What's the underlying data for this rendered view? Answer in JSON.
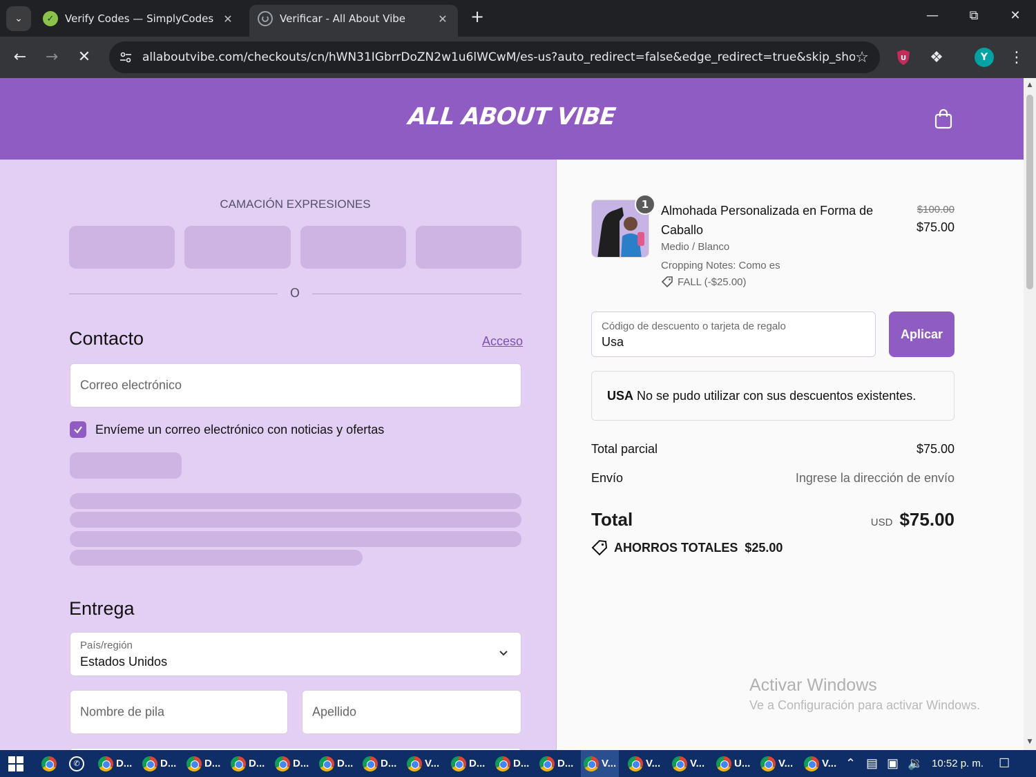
{
  "browser": {
    "tabs": [
      {
        "title": "Verify Codes — SimplyCodes",
        "active": false
      },
      {
        "title": "Verificar - All About Vibe",
        "active": true
      }
    ],
    "url": "allaboutvibe.com/checkouts/cn/hWN31IGbrrDoZN2w1u6lWCwM/es-us?auto_redirect=false&edge_redirect=true&skip_shop...",
    "profile_initial": "Y"
  },
  "store": {
    "logo_text": "ALL ABOUT VIBE",
    "brand_color": "#8e5cc3"
  },
  "express": {
    "title": "CAMACIÓN EXPRESIONES",
    "divider": "O"
  },
  "contact": {
    "heading": "Contacto",
    "login_link": "Acceso",
    "email_placeholder": "Correo electrónico",
    "newsletter_label": "Envíeme un correo electrónico con noticias y ofertas",
    "newsletter_checked": true
  },
  "delivery": {
    "heading": "Entrega",
    "country_label": "País/región",
    "country_value": "Estados Unidos",
    "first_name_placeholder": "Nombre de pila",
    "last_name_placeholder": "Apellido"
  },
  "order": {
    "item": {
      "name": "Almohada Personalizada en Forma de Caballo",
      "quantity": "1",
      "variant": "Medio / Blanco",
      "note": "Cropping Notes: Como es",
      "discount": "FALL (-$25.00)",
      "original_price": "$100.00",
      "price": "$75.00"
    },
    "discount_field": {
      "label": "Código de descuento o tarjeta de regalo",
      "value": "Usa",
      "apply_label": "Aplicar"
    },
    "error": {
      "code": "USA",
      "message": " No se pudo utilizar con sus descuentos existentes."
    },
    "subtotal_label": "Total parcial",
    "subtotal_value": "$75.00",
    "shipping_label": "Envío",
    "shipping_value": "Ingrese la dirección de envío",
    "total_label": "Total",
    "total_currency": "USD",
    "total_value": "$75.00",
    "savings_label": "AHORROS TOTALES",
    "savings_value": "$25.00"
  },
  "watermark": {
    "line1": "Activar Windows",
    "line2": "Ve a Configuración para activar Windows."
  },
  "taskbar": {
    "items": [
      "D...",
      "D...",
      "D...",
      "D...",
      "D...",
      "D...",
      "D...",
      "V...",
      "D...",
      "D...",
      "D...",
      "V...",
      "V...",
      "V...",
      "U...",
      "V...",
      "V..."
    ],
    "clock": "10:52 p. m."
  }
}
